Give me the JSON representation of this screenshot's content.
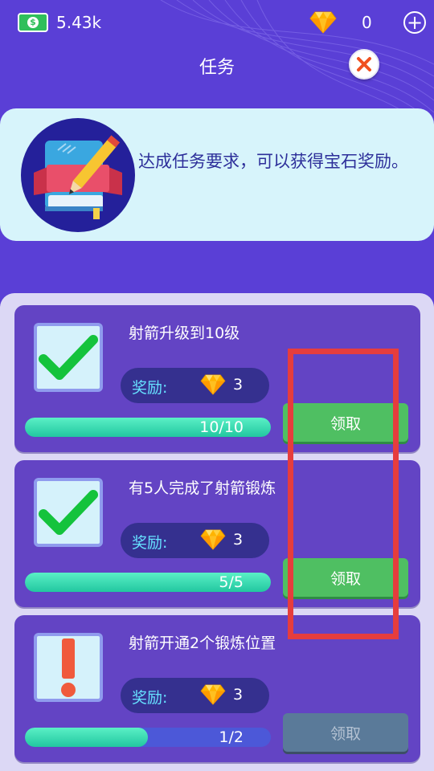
{
  "topbar": {
    "cash_value": "5.43k",
    "cash_symbol": "$",
    "gem_count": "0",
    "plus_symbol": "+"
  },
  "header": {
    "title": "任务"
  },
  "banner": {
    "text": "达成任务要求，可以获得宝石奖励。"
  },
  "tasks": [
    {
      "title": "射箭升级到10级",
      "reward_label": "奖励:",
      "reward_count": "3",
      "progress_text": "10/10",
      "progress": 1.0,
      "claim_label": "领取",
      "status_icon": "check-icon"
    },
    {
      "title": "有5人完成了射箭锻炼",
      "reward_label": "奖励:",
      "reward_count": "3",
      "progress_text": "5/5",
      "progress": 1.0,
      "claim_label": "领取",
      "status_icon": "check-icon"
    },
    {
      "title": "射箭开通2个锻炼位置",
      "reward_label": "奖励:",
      "reward_count": "3",
      "progress_text": "1/2",
      "progress": 0.5,
      "claim_label": "领取",
      "status_icon": "exclamation-icon"
    }
  ],
  "colors": {
    "background": "#5a3fd6",
    "card": "#6344c4",
    "claim_enabled": "#4fbf62",
    "claim_disabled": "#5a7a99",
    "highlight": "#e63d3d",
    "gem": "#ffb400"
  }
}
